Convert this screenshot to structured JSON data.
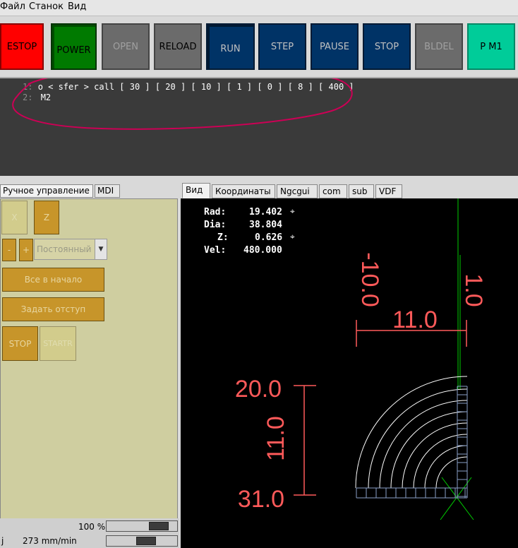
{
  "menu": [
    "Файл",
    "Станок",
    "Вид"
  ],
  "toolbar": {
    "estop": "ESTOP",
    "power": "POWER",
    "open": "OPEN",
    "reload": "RELOAD",
    "run": "RUN",
    "step": "STEP",
    "pause": "PAUSE",
    "stop": "STOP",
    "bldel": "BLDEL",
    "pm1": "P M1"
  },
  "editor": {
    "lines": [
      {
        "num": "1:",
        "text": "o < sfer > call [ 30 ] [ 20 ] [ 10 ] [ 1 ] [ 0 ] [ 8 ] [ 400 ]"
      },
      {
        "num": "2:",
        "text": "M2"
      }
    ]
  },
  "left_tabs": [
    "Ручное управление",
    "MDI"
  ],
  "manual": {
    "x": "X",
    "z": "Z",
    "minus": "-",
    "plus": "+",
    "jog_mode": "Постоянный",
    "home_all": "Все в начало",
    "touch_off": "Задать отступ",
    "stop": "STOP",
    "startr": "STARTR"
  },
  "status": {
    "feed_override": "100 %",
    "jog_label": "j",
    "jog_speed": "273 mm/min"
  },
  "right_tabs": [
    "Вид",
    "Координаты",
    "Ngcgui",
    "com",
    "sub",
    "VDF"
  ],
  "dro": {
    "rad_label": "Rad:",
    "rad_value": "19.402",
    "dia_label": "Dia:",
    "dia_value": "38.804",
    "z_label": "Z:",
    "z_value": "0.626",
    "vel_label": "Vel:",
    "vel_value": "480.000"
  },
  "dimensions": {
    "top_vertical": "-10.0",
    "right_vertical": "1.0",
    "horizontal": "11.0",
    "z_start": "20.0",
    "z_length": "11.0",
    "z_end": "31.0"
  },
  "colors": {
    "estop": "#ff0000",
    "power": "#007a00",
    "dark_blue": "#003366",
    "pm1": "#00cc99",
    "gray_button": "#666666",
    "annotation": "#cc0055",
    "dimension": "#ff5a5a",
    "toolpath": "#ffffff",
    "axis": "#00cc00"
  }
}
